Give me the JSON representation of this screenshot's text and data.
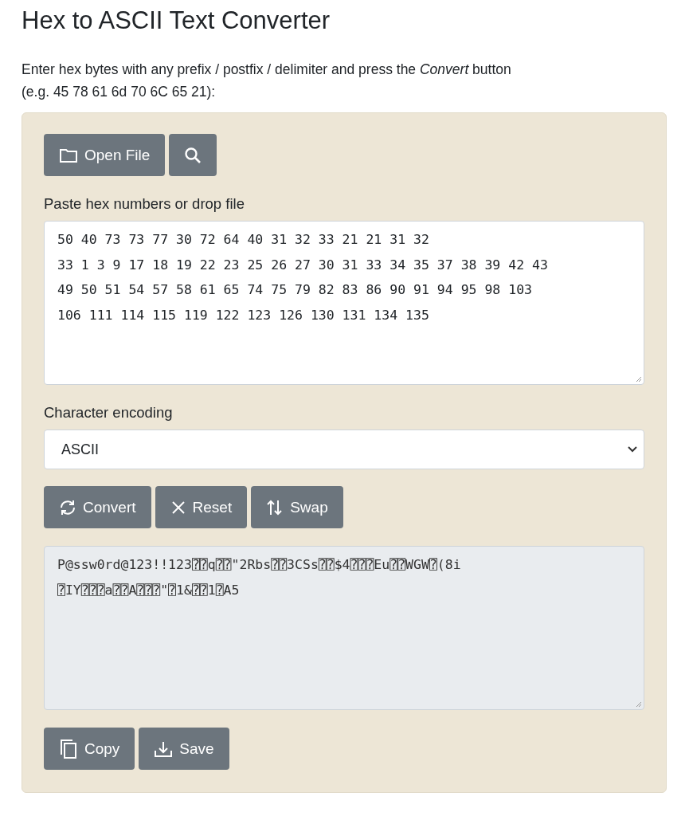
{
  "title": "Hex to ASCII Text Converter",
  "description": "Enter hex bytes with any prefix / postfix / delimiter and press the *Convert* button",
  "example": "(e.g. 45 78 61 6d 70 6C 65 21):",
  "file_buttons": [
    {
      "kind": "open",
      "label": "Open File"
    },
    {
      "kind": "search"
    }
  ],
  "input": {
    "label": "Paste hex numbers or drop file",
    "lines": [
      "50 40 73 73 77 30 72 64 40 31 32 33 21 21 31 32",
      "33 1 3 9 17 18 19 22 23 25 26 27 30 31 33 34 35 37 38 39 42 43",
      "49 50 51 54 57 58 61 65 74 75 79 82 83 86 90 91 94 95 98 103",
      "106 111 114 115 119 122 123 126 130 131 134 135"
    ]
  },
  "encoding": {
    "label": "Character encoding",
    "value": "ASCII"
  },
  "action_buttons": [
    {
      "kind": "convert",
      "label": "Convert"
    },
    {
      "kind": "reset",
      "label": "Reset"
    },
    {
      "kind": "swap",
      "label": "Swap"
    }
  ],
  "output": {
    "lines": [
      "P@ssw0rd@123!!123⍰⍰q⍰⍰\"2Rbs⍰⍰3CSs⍰⍰$4⍰⍰⍰Eu⍰⍰WGW⍰(8i",
      "⍰IY⍰⍰⍰a⍰⍰A⍰⍰⍰\"⍰1&⍰⍰1⍰A5"
    ]
  },
  "output_buttons": [
    {
      "kind": "copy",
      "label": "Copy"
    },
    {
      "kind": "save",
      "label": "Save"
    }
  ]
}
